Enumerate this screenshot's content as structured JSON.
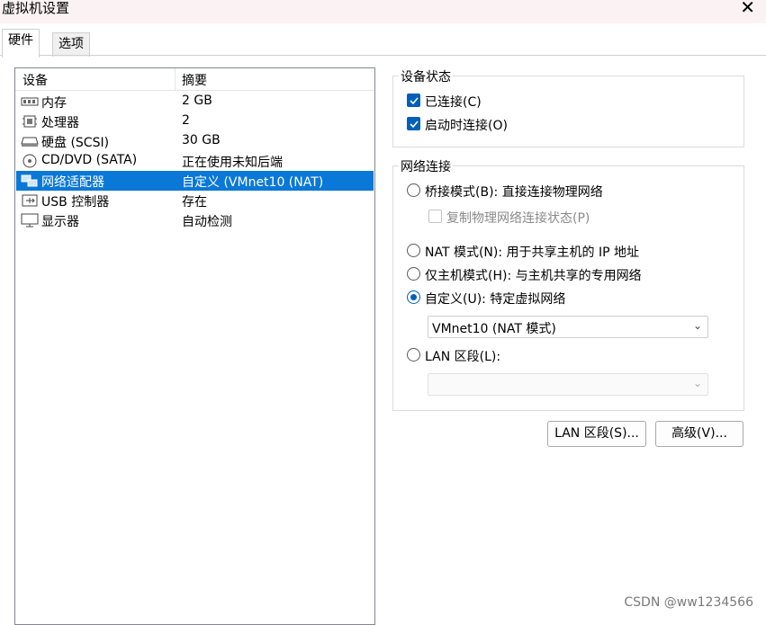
{
  "window": {
    "title": "虚拟机设置",
    "close_glyph": "✕"
  },
  "tabs": [
    {
      "label": "硬件",
      "active": true
    },
    {
      "label": "选项",
      "active": false
    }
  ],
  "device_list": {
    "columns": [
      "设备",
      "摘要"
    ],
    "rows": [
      {
        "icon": "memory-icon",
        "name": "内存",
        "summary": "2 GB",
        "selected": false
      },
      {
        "icon": "processor-icon",
        "name": "处理器",
        "summary": "2",
        "selected": false
      },
      {
        "icon": "hard-disk-icon",
        "name": "硬盘 (SCSI)",
        "summary": "30 GB",
        "selected": false
      },
      {
        "icon": "cd-dvd-icon",
        "name": "CD/DVD (SATA)",
        "summary": "正在使用未知后端",
        "selected": false
      },
      {
        "icon": "network-adapter-icon",
        "name": "网络适配器",
        "summary": "自定义 (VMnet10 (NAT)",
        "selected": true
      },
      {
        "icon": "usb-icon",
        "name": "USB 控制器",
        "summary": "存在",
        "selected": false
      },
      {
        "icon": "display-icon",
        "name": "显示器",
        "summary": "自动检测",
        "selected": false
      }
    ]
  },
  "device_status": {
    "title": "设备状态",
    "connected": {
      "label": "已连接(C)",
      "checked": true
    },
    "connect_at_power_on": {
      "label": "启动时连接(O)",
      "checked": true
    }
  },
  "network_connection": {
    "title": "网络连接",
    "bridged": {
      "label": "桥接模式(B): 直接连接物理网络",
      "selected": false
    },
    "replicate_state": {
      "label": "复制物理网络连接状态(P)",
      "checked": false,
      "enabled": false
    },
    "nat": {
      "label": "NAT 模式(N): 用于共享主机的 IP 地址",
      "selected": false
    },
    "host_only": {
      "label": "仅主机模式(H): 与主机共享的专用网络",
      "selected": false
    },
    "custom": {
      "label": "自定义(U): 特定虚拟网络",
      "selected": true
    },
    "custom_select_value": "VMnet10 (NAT 模式)",
    "lan_segment": {
      "label": "LAN 区段(L):",
      "selected": false
    },
    "lan_select_value": ""
  },
  "buttons": {
    "lan_segments": "LAN 区段(S)...",
    "advanced": "高级(V)..."
  },
  "watermark": "CSDN @ww1234566",
  "colors": {
    "accent": "#005fb8",
    "selection": "#0a78d7"
  }
}
